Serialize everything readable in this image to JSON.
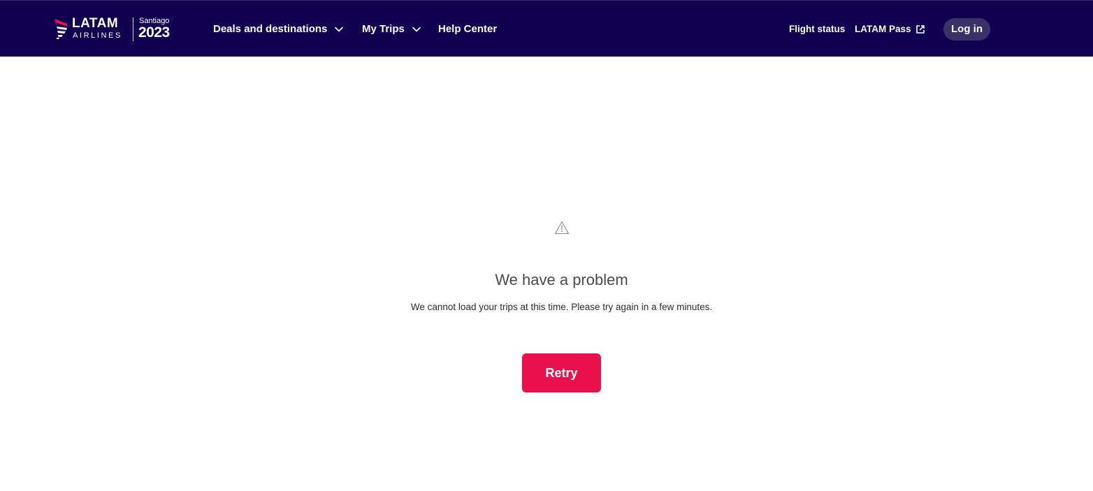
{
  "header": {
    "logo": {
      "brand": "LATAM",
      "subbrand": "AIRLINES",
      "event_name": "Santiago",
      "event_year": "2023",
      "icon": "latam-logo-mark"
    },
    "nav": [
      {
        "label": "Deals and destinations",
        "icon": "chevron-down-icon"
      },
      {
        "label": "My Trips",
        "icon": "chevron-down-icon"
      },
      {
        "label": "Help Center"
      }
    ],
    "flight_status_label": "Flight status",
    "latam_pass_label": "LATAM Pass",
    "latam_pass_icon": "external-link-icon",
    "login_label": "Log in"
  },
  "error": {
    "icon": "warning-icon",
    "title": "We have a problem",
    "message": "We cannot load your trips at this time. Please try again in a few minutes.",
    "retry_label": "Retry"
  },
  "colors": {
    "header_bg": "#10004f",
    "login_bg": "#3b3169",
    "accent": "#e8114b",
    "title_text": "#4a4a4a",
    "body_text": "#2b2b2b"
  }
}
